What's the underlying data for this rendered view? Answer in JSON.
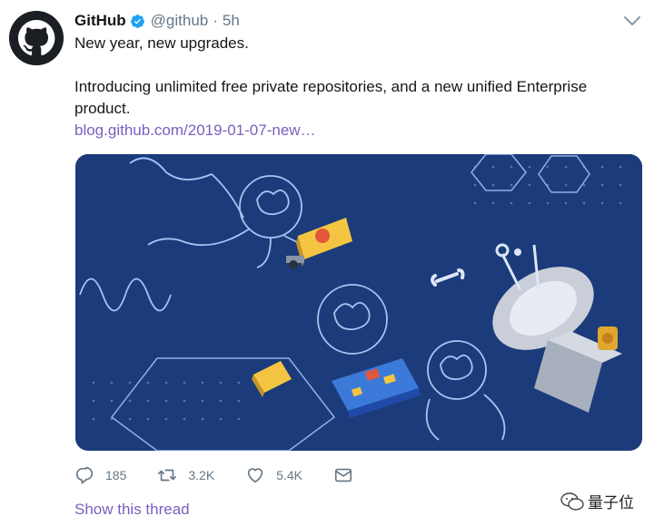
{
  "tweet": {
    "name": "GitHub",
    "handle": "@github",
    "separator": "·",
    "time": "5h",
    "line1": "New year, new upgrades.",
    "line2": "Introducing unlimited free private repositories, and a new unified Enterprise product.",
    "link": "blog.github.com/2019-01-07-new…"
  },
  "actions": {
    "replies": "185",
    "retweets": "3.2K",
    "likes": "5.4K"
  },
  "show_thread": "Show this thread",
  "watermark": "量子位",
  "icons": {
    "avatar": "github-octocat-icon",
    "verified": "verified-badge-icon",
    "caret": "chevron-down-icon",
    "reply": "reply-icon",
    "retweet": "retweet-icon",
    "like": "heart-icon",
    "dm": "envelope-icon"
  },
  "colors": {
    "link": "#7b5fbf",
    "muted": "#657786",
    "verified": "#1da1f2",
    "media_bg": "#1b3b7a"
  }
}
